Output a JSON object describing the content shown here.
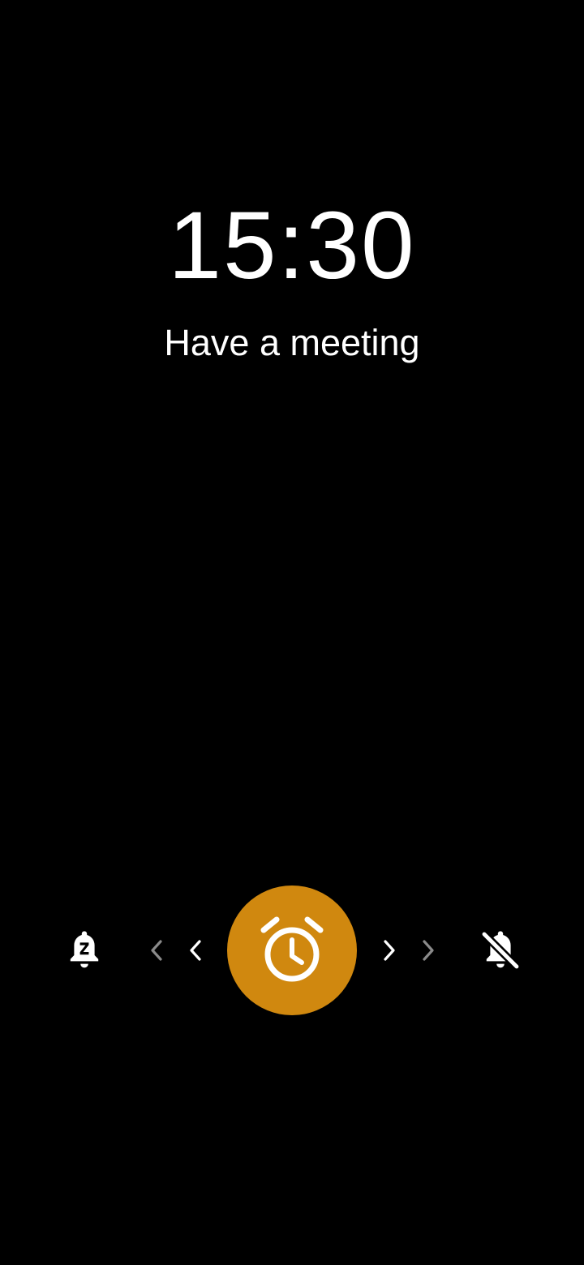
{
  "alarm": {
    "time": "15:30",
    "label": "Have a meeting"
  },
  "controls": {
    "snooze_icon": "snooze-bell-icon",
    "dismiss_icon": "notifications-off-icon",
    "handle_icon": "alarm-clock-icon",
    "left_hint_icons": [
      "chevron-left-icon",
      "chevron-left-icon"
    ],
    "right_hint_icons": [
      "chevron-right-icon",
      "chevron-right-icon"
    ]
  },
  "colors": {
    "background": "#000000",
    "text": "#ffffff",
    "accent": "#D0880F",
    "hint_dim": "#8a8a8a"
  }
}
